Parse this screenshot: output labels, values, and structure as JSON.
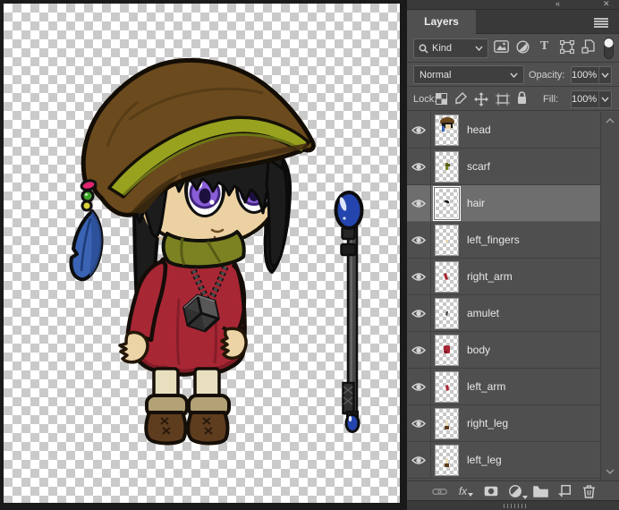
{
  "window": {
    "collapse_glyph": "«",
    "close_glyph": "✕"
  },
  "panel": {
    "tab_title": "Layers",
    "filter_bar": {
      "kind_label": "Kind",
      "type_icon_glyph": "T",
      "icons": [
        "search-icon",
        "pixel-layers-filter-icon",
        "adjustment-layers-filter-icon",
        "type-layers-filter-icon",
        "shape-layers-filter-icon",
        "smart-objects-filter-icon",
        "filtering-toggle"
      ]
    },
    "blend_row": {
      "mode": "Normal",
      "opacity_label": "Opacity:",
      "opacity_value": "100%"
    },
    "lock_row": {
      "label": "Lock:",
      "icons": [
        "lock-transparent-pixels-icon",
        "lock-image-pixels-icon",
        "lock-position-icon",
        "lock-artboard-icon",
        "lock-all-icon"
      ],
      "fill_label": "Fill:",
      "fill_value": "100%"
    },
    "layers": [
      {
        "name": "head",
        "selected": false,
        "visible": true
      },
      {
        "name": "scarf",
        "selected": false,
        "visible": true
      },
      {
        "name": "hair",
        "selected": true,
        "visible": true
      },
      {
        "name": "left_fingers",
        "selected": false,
        "visible": true
      },
      {
        "name": "right_arm",
        "selected": false,
        "visible": true
      },
      {
        "name": "amulet",
        "selected": false,
        "visible": true
      },
      {
        "name": "body",
        "selected": false,
        "visible": true
      },
      {
        "name": "left_arm",
        "selected": false,
        "visible": true
      },
      {
        "name": "right_leg",
        "selected": false,
        "visible": true
      },
      {
        "name": "left_leg",
        "selected": false,
        "visible": true
      }
    ],
    "toolbar": {
      "fx_label": "fx",
      "icons": [
        "link-layers-icon",
        "layer-style-icon",
        "layer-mask-icon",
        "adjustment-layer-icon",
        "new-group-icon",
        "new-layer-icon",
        "delete-layer-icon"
      ]
    }
  },
  "canvas": {
    "artwork_palette": {
      "hat_brown": "#6b4a1e",
      "band_olive": "#98a21f",
      "scarf_olive": "#7c8122",
      "dress_red": "#a82734",
      "skin": "#ecd2a2",
      "eye_purple": "#8a5ed8",
      "hair_black": "#1c1c1c",
      "feather_blue": "#3a63b4",
      "boot_brown": "#5e3d1f",
      "staff_orb_blue": "#2545ae",
      "checker_gray": "#cacaca"
    }
  }
}
